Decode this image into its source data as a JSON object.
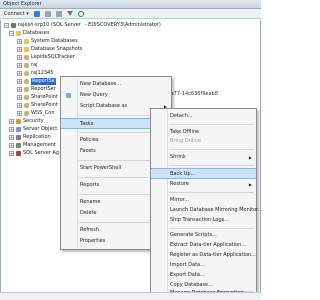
{
  "window": {
    "title": "Object Explorer"
  },
  "toolbar": {
    "connect_label": "Connect ▾"
  },
  "tree": {
    "server": "rajesh-srp10 (SQL Server",
    "server_suffix": "- EDISCOVERY3\\Administrator)",
    "databases": "Databases",
    "system_databases": "System Databases",
    "database_snapshots": "Database Snapshots",
    "lepide": "LepideSQLTracker",
    "raj": "raj",
    "raj12345": "raj12345",
    "selected_db": "ReportSe",
    "report_server2": "ReportSer",
    "sharepoint1": "SharePoint",
    "sharepoint2": "SharePoint",
    "wss": "WSS_Con",
    "security": "Security",
    "server_objects": "Server Object",
    "replication": "Replication",
    "management": "Management",
    "agent": "SQL Server Ag",
    "guid_tail": "4661-aa77-14c636f9eab8"
  },
  "context_menu": {
    "new_database": "New Database...",
    "new_query": "New Query",
    "script_database": "Script Database as",
    "tasks": "Tasks",
    "policies": "Policies",
    "facets": "Facets",
    "start_powershell": "Start PowerShell",
    "reports": "Reports",
    "rename": "Rename",
    "delete": "Delete",
    "refresh": "Refresh",
    "properties": "Properties"
  },
  "tasks_menu": {
    "detach": "Detach...",
    "take_offline": "Take Offline",
    "bring_online": "Bring Online",
    "shrink": "Shrink",
    "back_up": "Back Up...",
    "restore": "Restore",
    "mirror": "Mirror...",
    "launch_mirroring": "Launch Database Mirroring Monitor...",
    "ship_logs": "Ship Transaction Logs...",
    "generate_scripts": "Generate Scripts...",
    "extract_dac": "Extract Data-tier Application...",
    "register_dac": "Register as Data-tier Application...",
    "import_data": "Import Data...",
    "export_data": "Export Data...",
    "copy_database": "Copy Database...",
    "manage_encryption": "Manage Database Encryption..."
  },
  "colors": {
    "highlight": "#cfe2f6",
    "selection": "#3168c5"
  }
}
